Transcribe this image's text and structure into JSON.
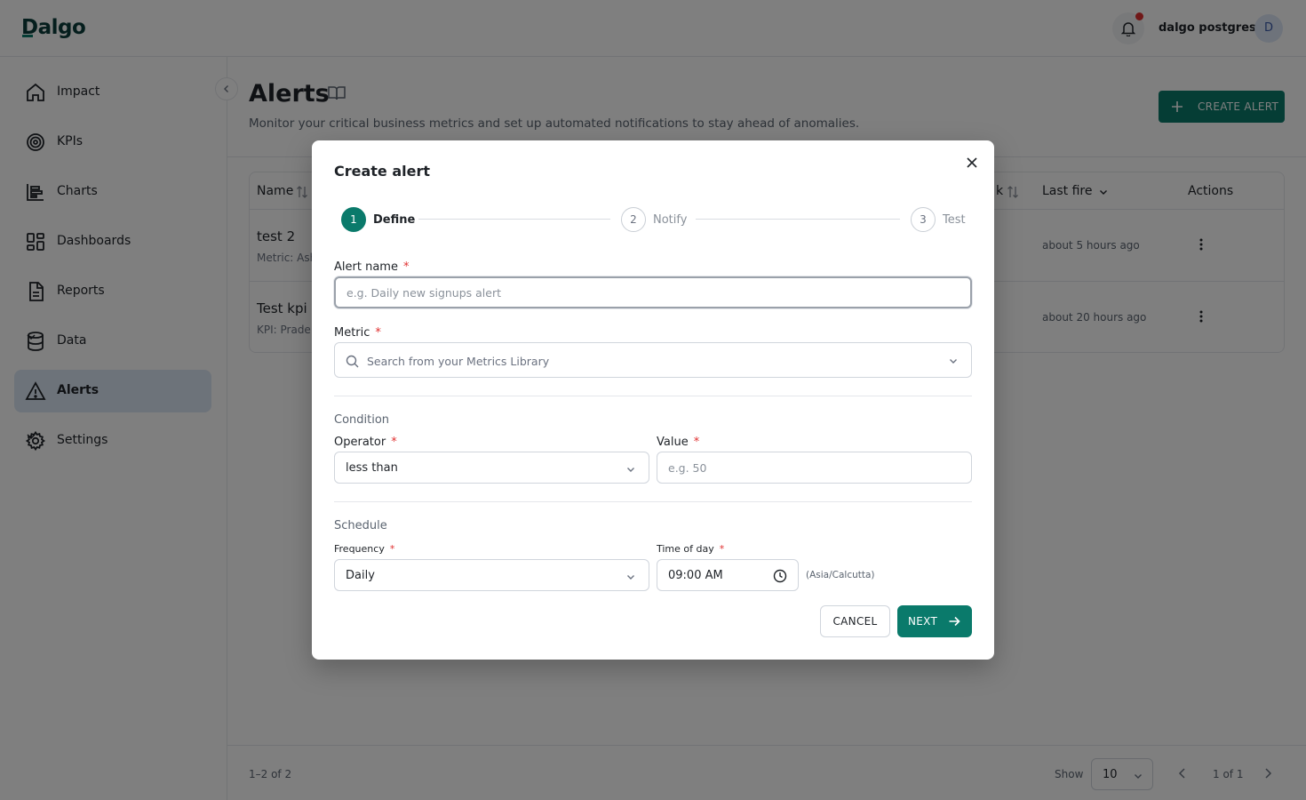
{
  "app": {
    "logo": "Dalgo"
  },
  "header": {
    "user_name": "dalgo postgres",
    "avatar_initial": "D"
  },
  "sidebar": {
    "items": [
      {
        "label": "Impact",
        "icon": "home-icon"
      },
      {
        "label": "KPIs",
        "icon": "target-icon"
      },
      {
        "label": "Charts",
        "icon": "chart-icon"
      },
      {
        "label": "Dashboards",
        "icon": "dashboard-icon"
      },
      {
        "label": "Reports",
        "icon": "report-icon"
      },
      {
        "label": "Data",
        "icon": "database-icon",
        "expandable": true
      },
      {
        "label": "Alerts",
        "icon": "alert-icon",
        "active": true
      },
      {
        "label": "Settings",
        "icon": "gear-icon",
        "expandable": true
      }
    ]
  },
  "page": {
    "title": "Alerts",
    "description": "Monitor your critical business metrics and set up automated notifications to stay ahead of anomalies.",
    "create_button": "CREATE ALERT"
  },
  "table": {
    "headers": {
      "name": "Name",
      "partial": "k",
      "last_fire": "Last fire",
      "actions": "Actions"
    },
    "rows": [
      {
        "name": "test 2",
        "subtitle": "Metric: Ash",
        "last_fire": "about 5 hours ago"
      },
      {
        "name": "Test kpi",
        "subtitle": "KPI: Prade",
        "last_fire": "about 20 hours ago"
      }
    ]
  },
  "footer": {
    "count": "1–2 of 2",
    "show_label": "Show",
    "page_size": "10",
    "page": "1 of 1"
  },
  "modal": {
    "title": "Create alert",
    "steps": [
      {
        "number": "1",
        "label": "Define"
      },
      {
        "number": "2",
        "label": "Notify"
      },
      {
        "number": "3",
        "label": "Test"
      }
    ],
    "alert_name": {
      "label": "Alert name",
      "placeholder": "e.g. Daily new signups alert",
      "value": ""
    },
    "metric": {
      "label": "Metric",
      "placeholder": "Search from your Metrics Library"
    },
    "condition": {
      "section": "Condition",
      "operator_label": "Operator",
      "operator_value": "less than",
      "value_label": "Value",
      "value_placeholder": "e.g. 50"
    },
    "schedule": {
      "section": "Schedule",
      "frequency_label": "Frequency",
      "frequency_value": "Daily",
      "time_label": "Time of day",
      "time_value": "09:00 AM",
      "timezone": "(Asia/Calcutta)"
    },
    "required_mark": "*",
    "cancel": "CANCEL",
    "next": "NEXT"
  },
  "colors": {
    "accent": "#0a7a6b",
    "active_nav": "#dbe7f4",
    "required": "#e03131"
  }
}
